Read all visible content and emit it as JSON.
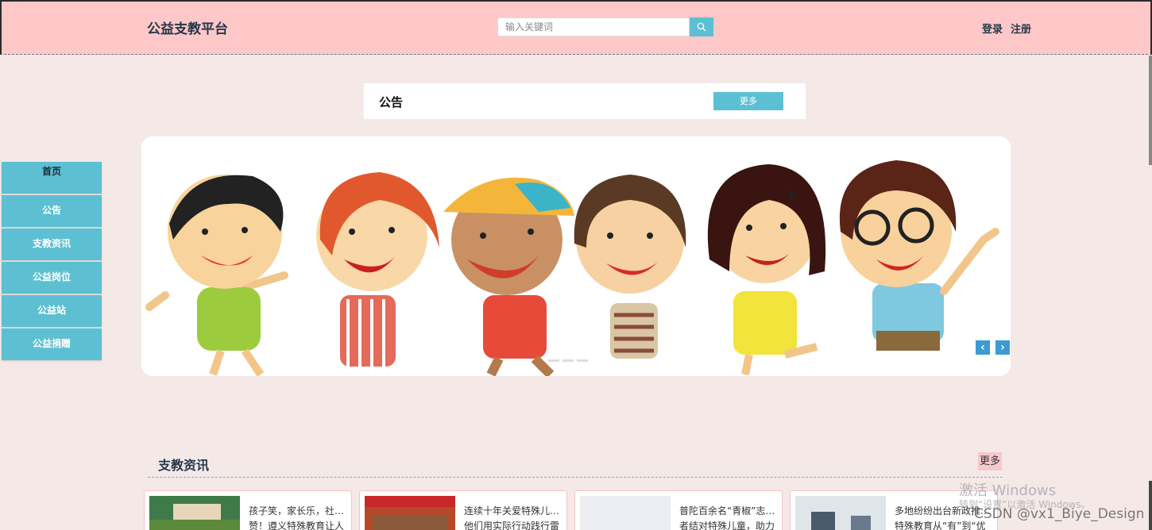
{
  "header": {
    "brand": "公益支教平台",
    "search_placeholder": "输入关键词",
    "login": "登录",
    "register": "注册"
  },
  "notice": {
    "title": "公告",
    "more": "更多"
  },
  "sidenav": {
    "items": [
      {
        "label": "首页"
      },
      {
        "label": "公告"
      },
      {
        "label": "支教资讯"
      },
      {
        "label": "公益岗位"
      },
      {
        "label": "公益站"
      },
      {
        "label": "公益捐赠"
      }
    ]
  },
  "banner": {
    "prev": "‹",
    "next": "›"
  },
  "news": {
    "title": "支教资讯",
    "more": "更多",
    "cards": [
      {
        "line1": "孩子笑，家长乐，社…",
        "line2": "赞！遵义特殊教育让人"
      },
      {
        "line1": "连续十年关爱特殊儿…",
        "line2": "他们用实际行动践行雷"
      },
      {
        "line1": "普陀百余名“青椒”志…",
        "line2": "者结对特殊儿童，助力"
      },
      {
        "line1": "多地纷纷出台新政推…",
        "line2": "特殊教育从“有”到“优"
      }
    ]
  },
  "overlay": {
    "watermark": "激活 Windows",
    "watermark_sub": "转到“设置”以激活 Windows。",
    "csdn": "CSDN @vx1_Biye_Design"
  },
  "colors": {
    "header_bg": "#ffc8c8",
    "accent": "#5cc0d2",
    "page_bg": "#f5e9e8"
  }
}
